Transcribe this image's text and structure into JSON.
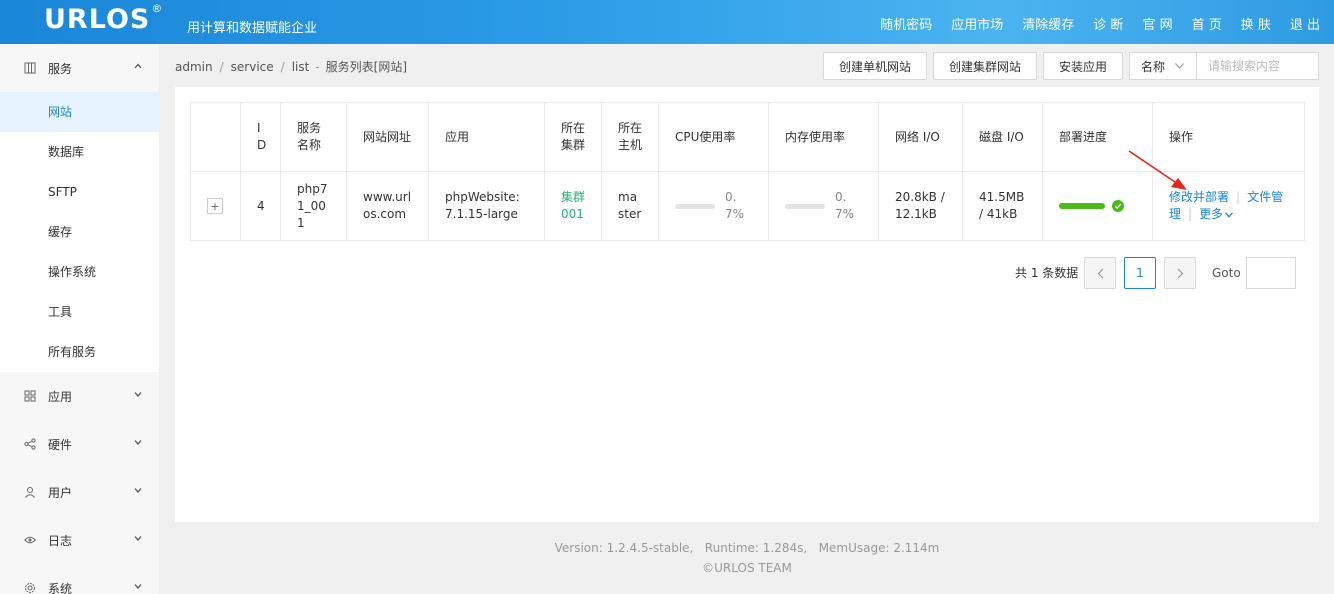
{
  "header": {
    "logo": "URLOS",
    "logo_mark": "®",
    "slogan": "用计算和数据赋能企业",
    "nav": [
      "随机密码",
      "应用市场",
      "清除缓存",
      "诊 断",
      "官 网",
      "首 页",
      "换 肤",
      "退 出"
    ]
  },
  "sidebar": {
    "service_group": "服务",
    "service_items": [
      "网站",
      "数据库",
      "SFTP",
      "缓存",
      "操作系统",
      "工具",
      "所有服务"
    ],
    "groups": [
      "应用",
      "硬件",
      "用户",
      "日志",
      "系统"
    ]
  },
  "breadcrumb": {
    "p1": "admin",
    "p2": "service",
    "p3": "list",
    "title": "服务列表[网站]"
  },
  "toolbar": {
    "create_single": "创建单机网站",
    "create_cluster": "创建集群网站",
    "install_app": "安装应用",
    "select_value": "名称",
    "search_placeholder": "请输搜索内容"
  },
  "table": {
    "headers": [
      "ID",
      "服务名称",
      "网站网址",
      "应用",
      "所在集群",
      "所在主机",
      "CPU使用率",
      "内存使用率",
      "网络 I/O",
      "磁盘 I/O",
      "部署进度",
      "操作"
    ],
    "row": {
      "expand": "+",
      "id": "4",
      "name": "php71_001",
      "url": "www.urlos.com",
      "app": "phpWebsite:7.1.15-large",
      "cluster": "集群001",
      "host": "master",
      "cpu": "0.7%",
      "cpu_level": 0.007,
      "mem": "0.7%",
      "mem_level": 0.007,
      "net": "20.8kB / 12.1kB",
      "disk": "41.5MB / 41kB",
      "deploy_level": 1.0
    },
    "actions": {
      "edit_deploy": "修改并部署",
      "file_manage": "文件管理",
      "more": "更多"
    }
  },
  "pagination": {
    "total": "共 1 条数据",
    "current": "1",
    "goto_label": "Goto"
  },
  "footer": {
    "line1": "Version: 1.2.4.5-stable,   Runtime: 1.284s,   MemUsage: 2.114m",
    "line2": "©URLOS TEAM"
  },
  "colors": {
    "primary": "#1a86d8",
    "success": "#4cbb17",
    "cluster": "#2ab27b",
    "annotation": "#e8231b"
  }
}
